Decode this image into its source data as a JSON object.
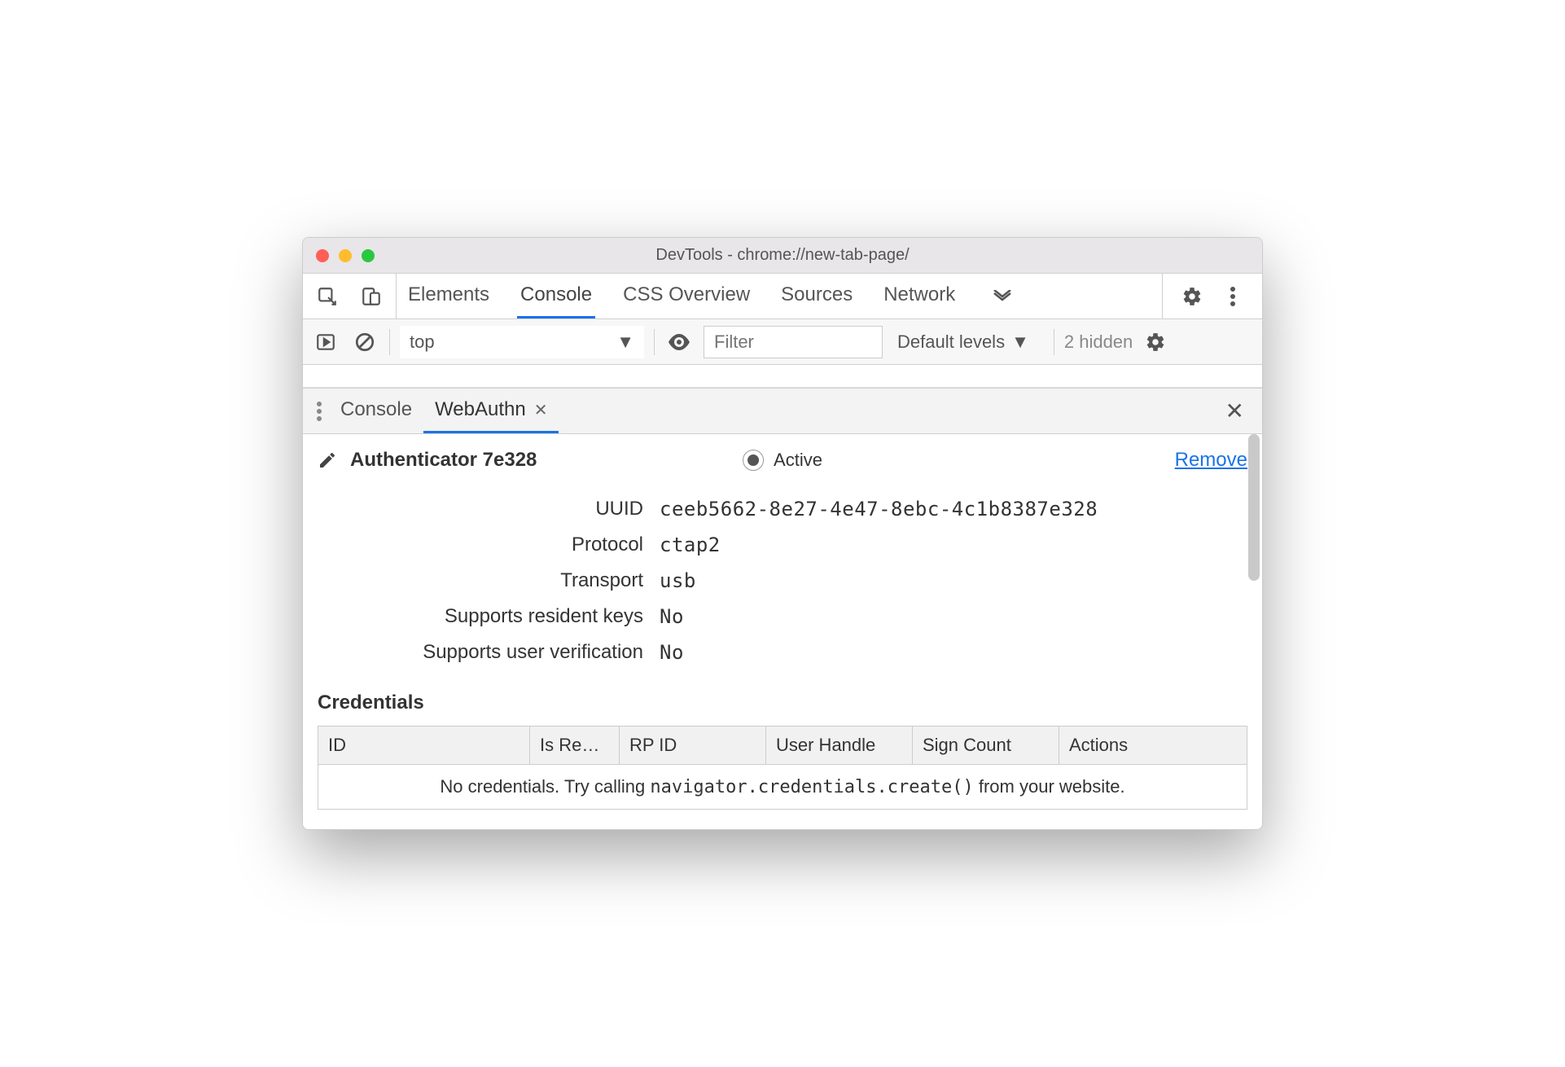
{
  "window": {
    "title": "DevTools - chrome://new-tab-page/"
  },
  "tabs": {
    "items": [
      "Elements",
      "Console",
      "CSS Overview",
      "Sources",
      "Network"
    ],
    "active_index": 1
  },
  "console_toolbar": {
    "context": "top",
    "filter_placeholder": "Filter",
    "levels_label": "Default levels",
    "hidden_label": "2 hidden"
  },
  "drawer": {
    "tabs": [
      "Console",
      "WebAuthn"
    ],
    "active_index": 1
  },
  "authenticator": {
    "title": "Authenticator 7e328",
    "active_label": "Active",
    "remove_label": "Remove",
    "fields": {
      "uuid_label": "UUID",
      "uuid_value": "ceeb5662-8e27-4e47-8ebc-4c1b8387e328",
      "protocol_label": "Protocol",
      "protocol_value": "ctap2",
      "transport_label": "Transport",
      "transport_value": "usb",
      "resident_label": "Supports resident keys",
      "resident_value": "No",
      "uv_label": "Supports user verification",
      "uv_value": "No"
    }
  },
  "credentials": {
    "title": "Credentials",
    "columns": [
      "ID",
      "Is Re…",
      "RP ID",
      "User Handle",
      "Sign Count",
      "Actions"
    ],
    "empty_before": "No credentials. Try calling ",
    "empty_code": "navigator.credentials.create()",
    "empty_after": " from your website."
  }
}
